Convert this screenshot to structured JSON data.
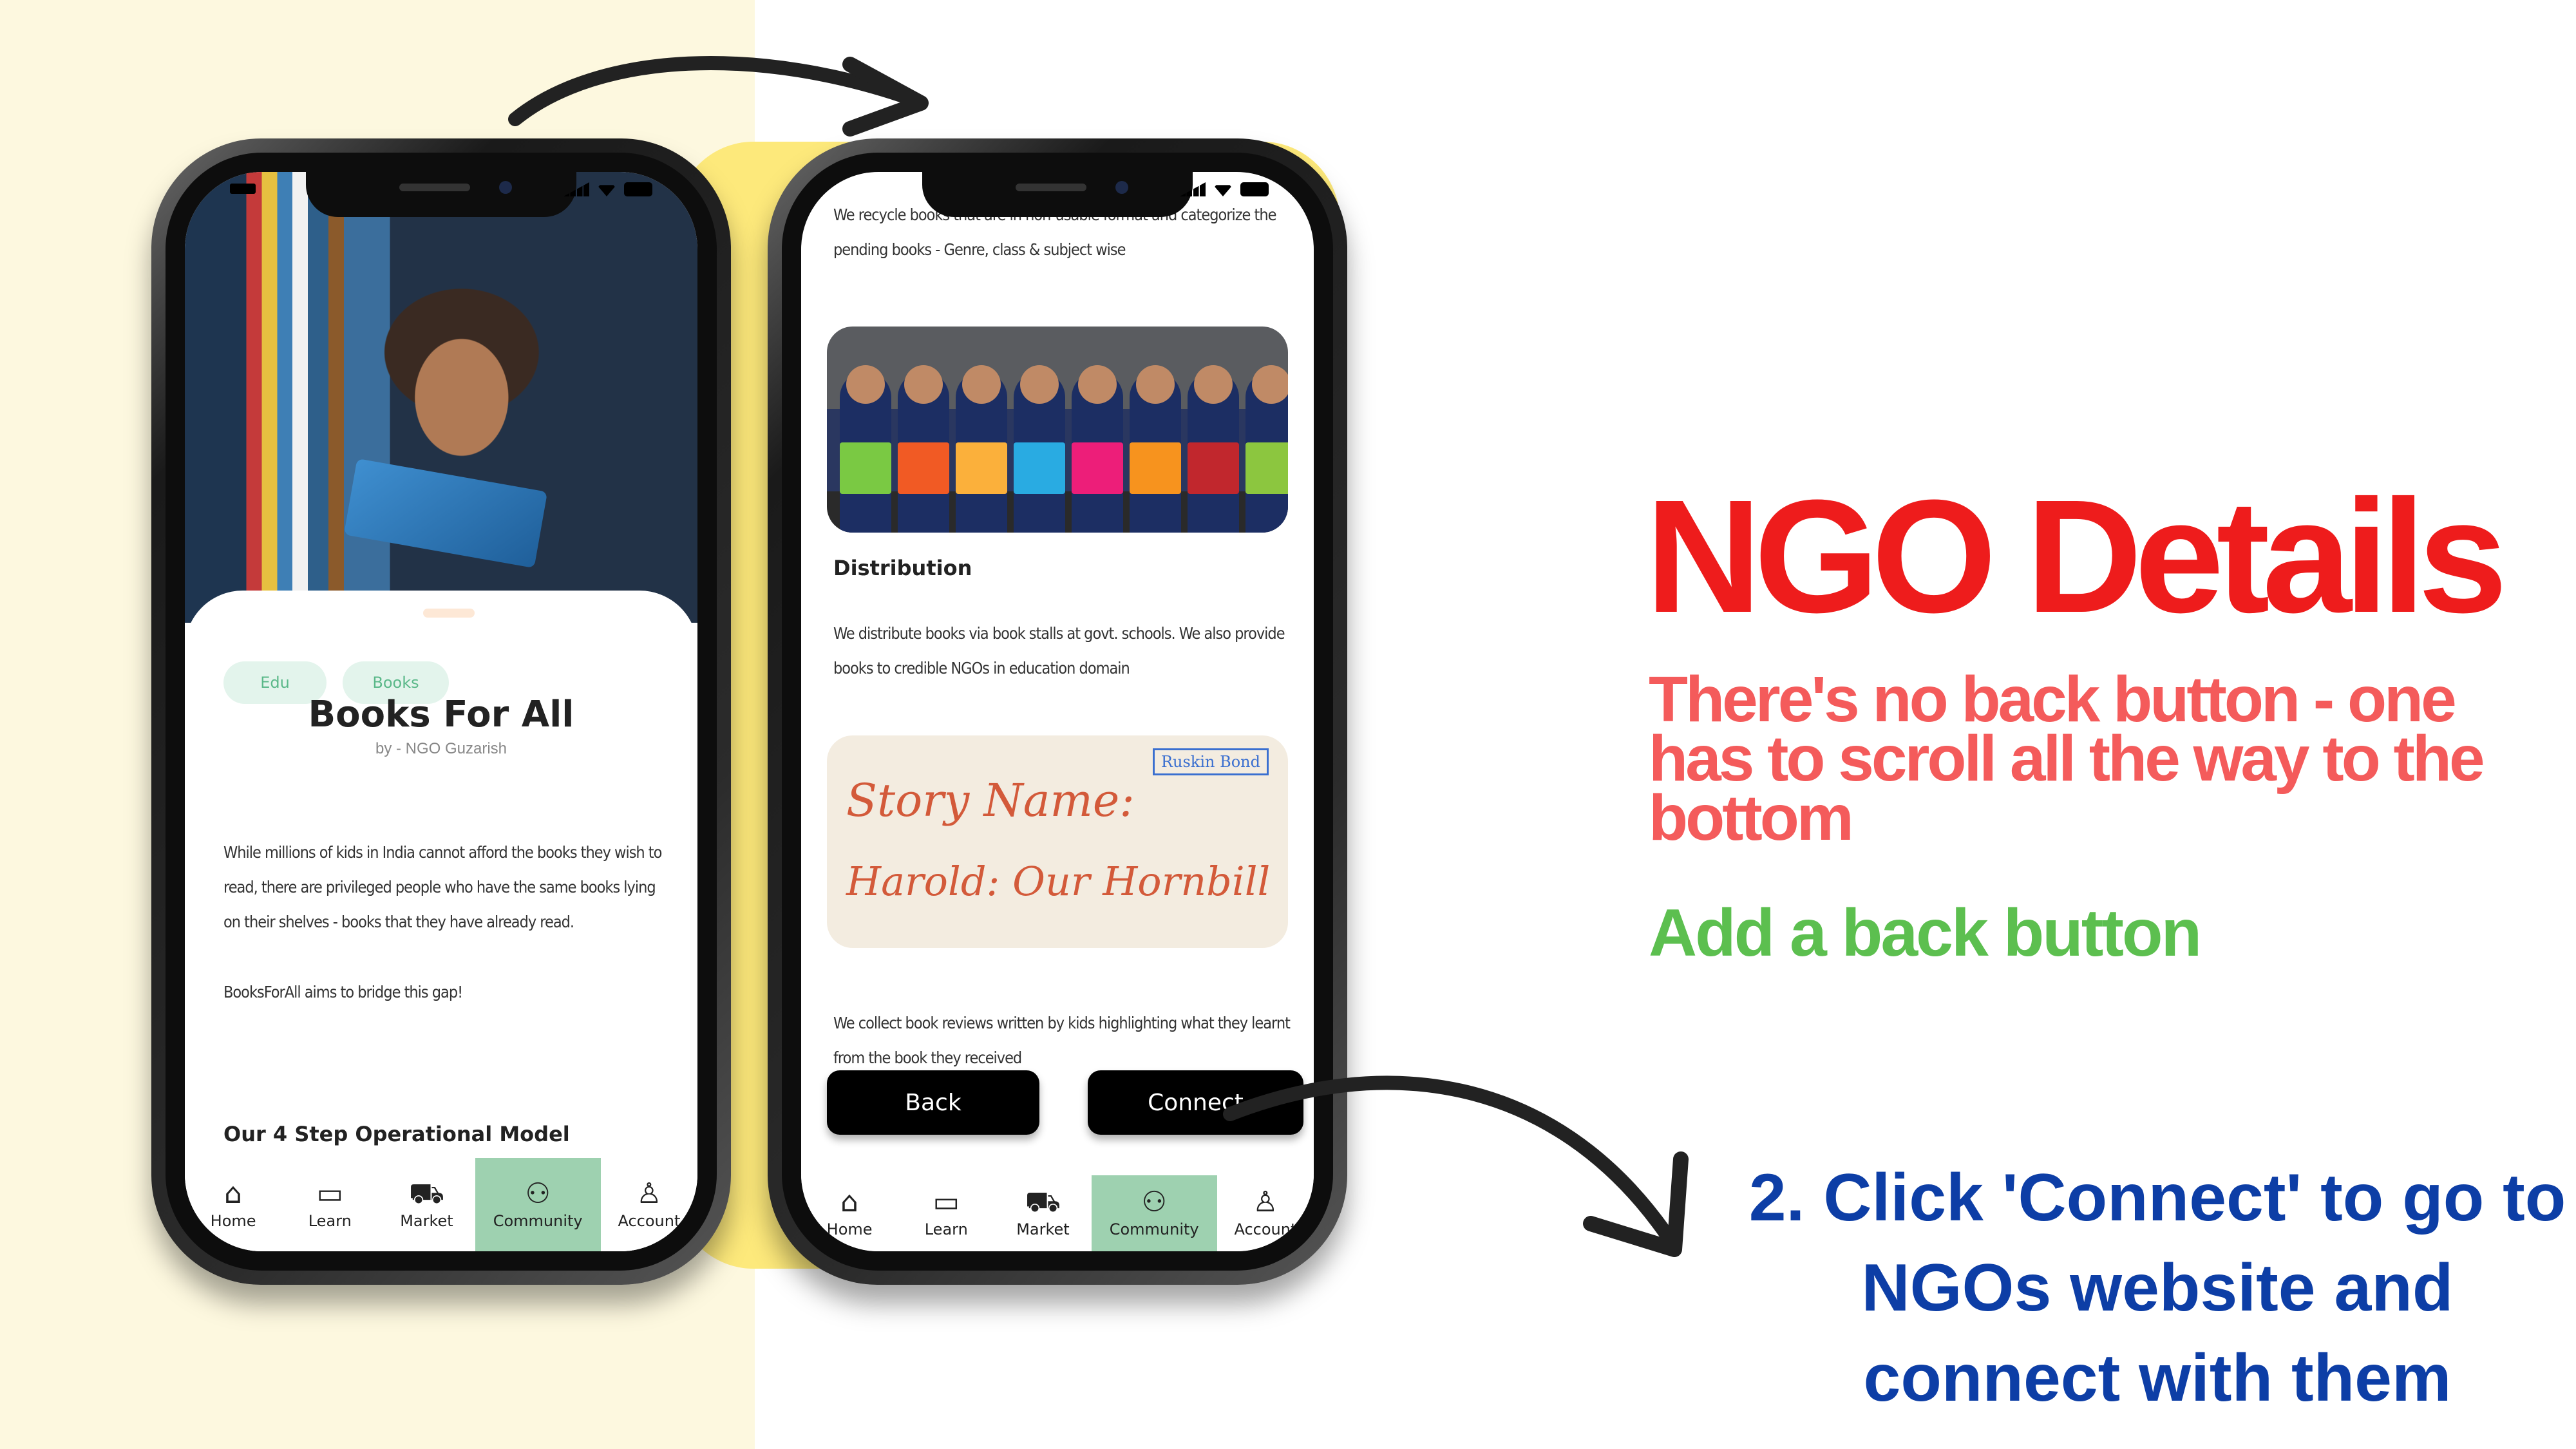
{
  "annotations": {
    "title": "NGO Details",
    "issue": "There's no back button - one has to scroll all the way to the bottom",
    "fix": "Add a back button",
    "step": "2. Click 'Connect' to go to NGOs website and connect with them"
  },
  "colors": {
    "title_red": "#ee1c1c",
    "issue_red": "#f45b5b",
    "fix_green": "#5cbf4f",
    "step_blue": "#0d3ea6",
    "nav_active": "#9ed1b0",
    "tag_bg": "#e3f4ec"
  },
  "phone1": {
    "tags": [
      "Edu",
      "Books"
    ],
    "title": "Books For All",
    "byline": "by - NGO Guzarish",
    "description_1": "While millions of kids in India cannot afford the books they wish to read, there are privileged people who have the same books lying on their shelves - books that they have already read.",
    "description_2": "BooksForAll aims to bridge this gap!",
    "section_heading": "Our 4 Step Operational Model"
  },
  "phone2": {
    "intro_text": "We recycle books that are in non-usable format and categorize the pending books - Genre, class & subject wise",
    "distribution_heading": "Distribution",
    "distribution_text": "We distribute books via book stalls at govt. schools. We also provide books to credible NGOs in education domain",
    "photo2_text": {
      "label": "Ruskin Bond",
      "line1": "Story Name:",
      "line2": "Harold: Our Hornbill"
    },
    "review_text": "We collect book reviews written by kids highlighting what they learnt from the book they received",
    "back_button": "Back",
    "connect_button": "Connect"
  },
  "nav": {
    "items": [
      {
        "label": "Home",
        "icon": "store-icon"
      },
      {
        "label": "Learn",
        "icon": "book-open-icon"
      },
      {
        "label": "Market",
        "icon": "cart-icon"
      },
      {
        "label": "Community",
        "icon": "community-icon"
      },
      {
        "label": "Account",
        "icon": "user-icon"
      }
    ],
    "active_index": 3
  }
}
